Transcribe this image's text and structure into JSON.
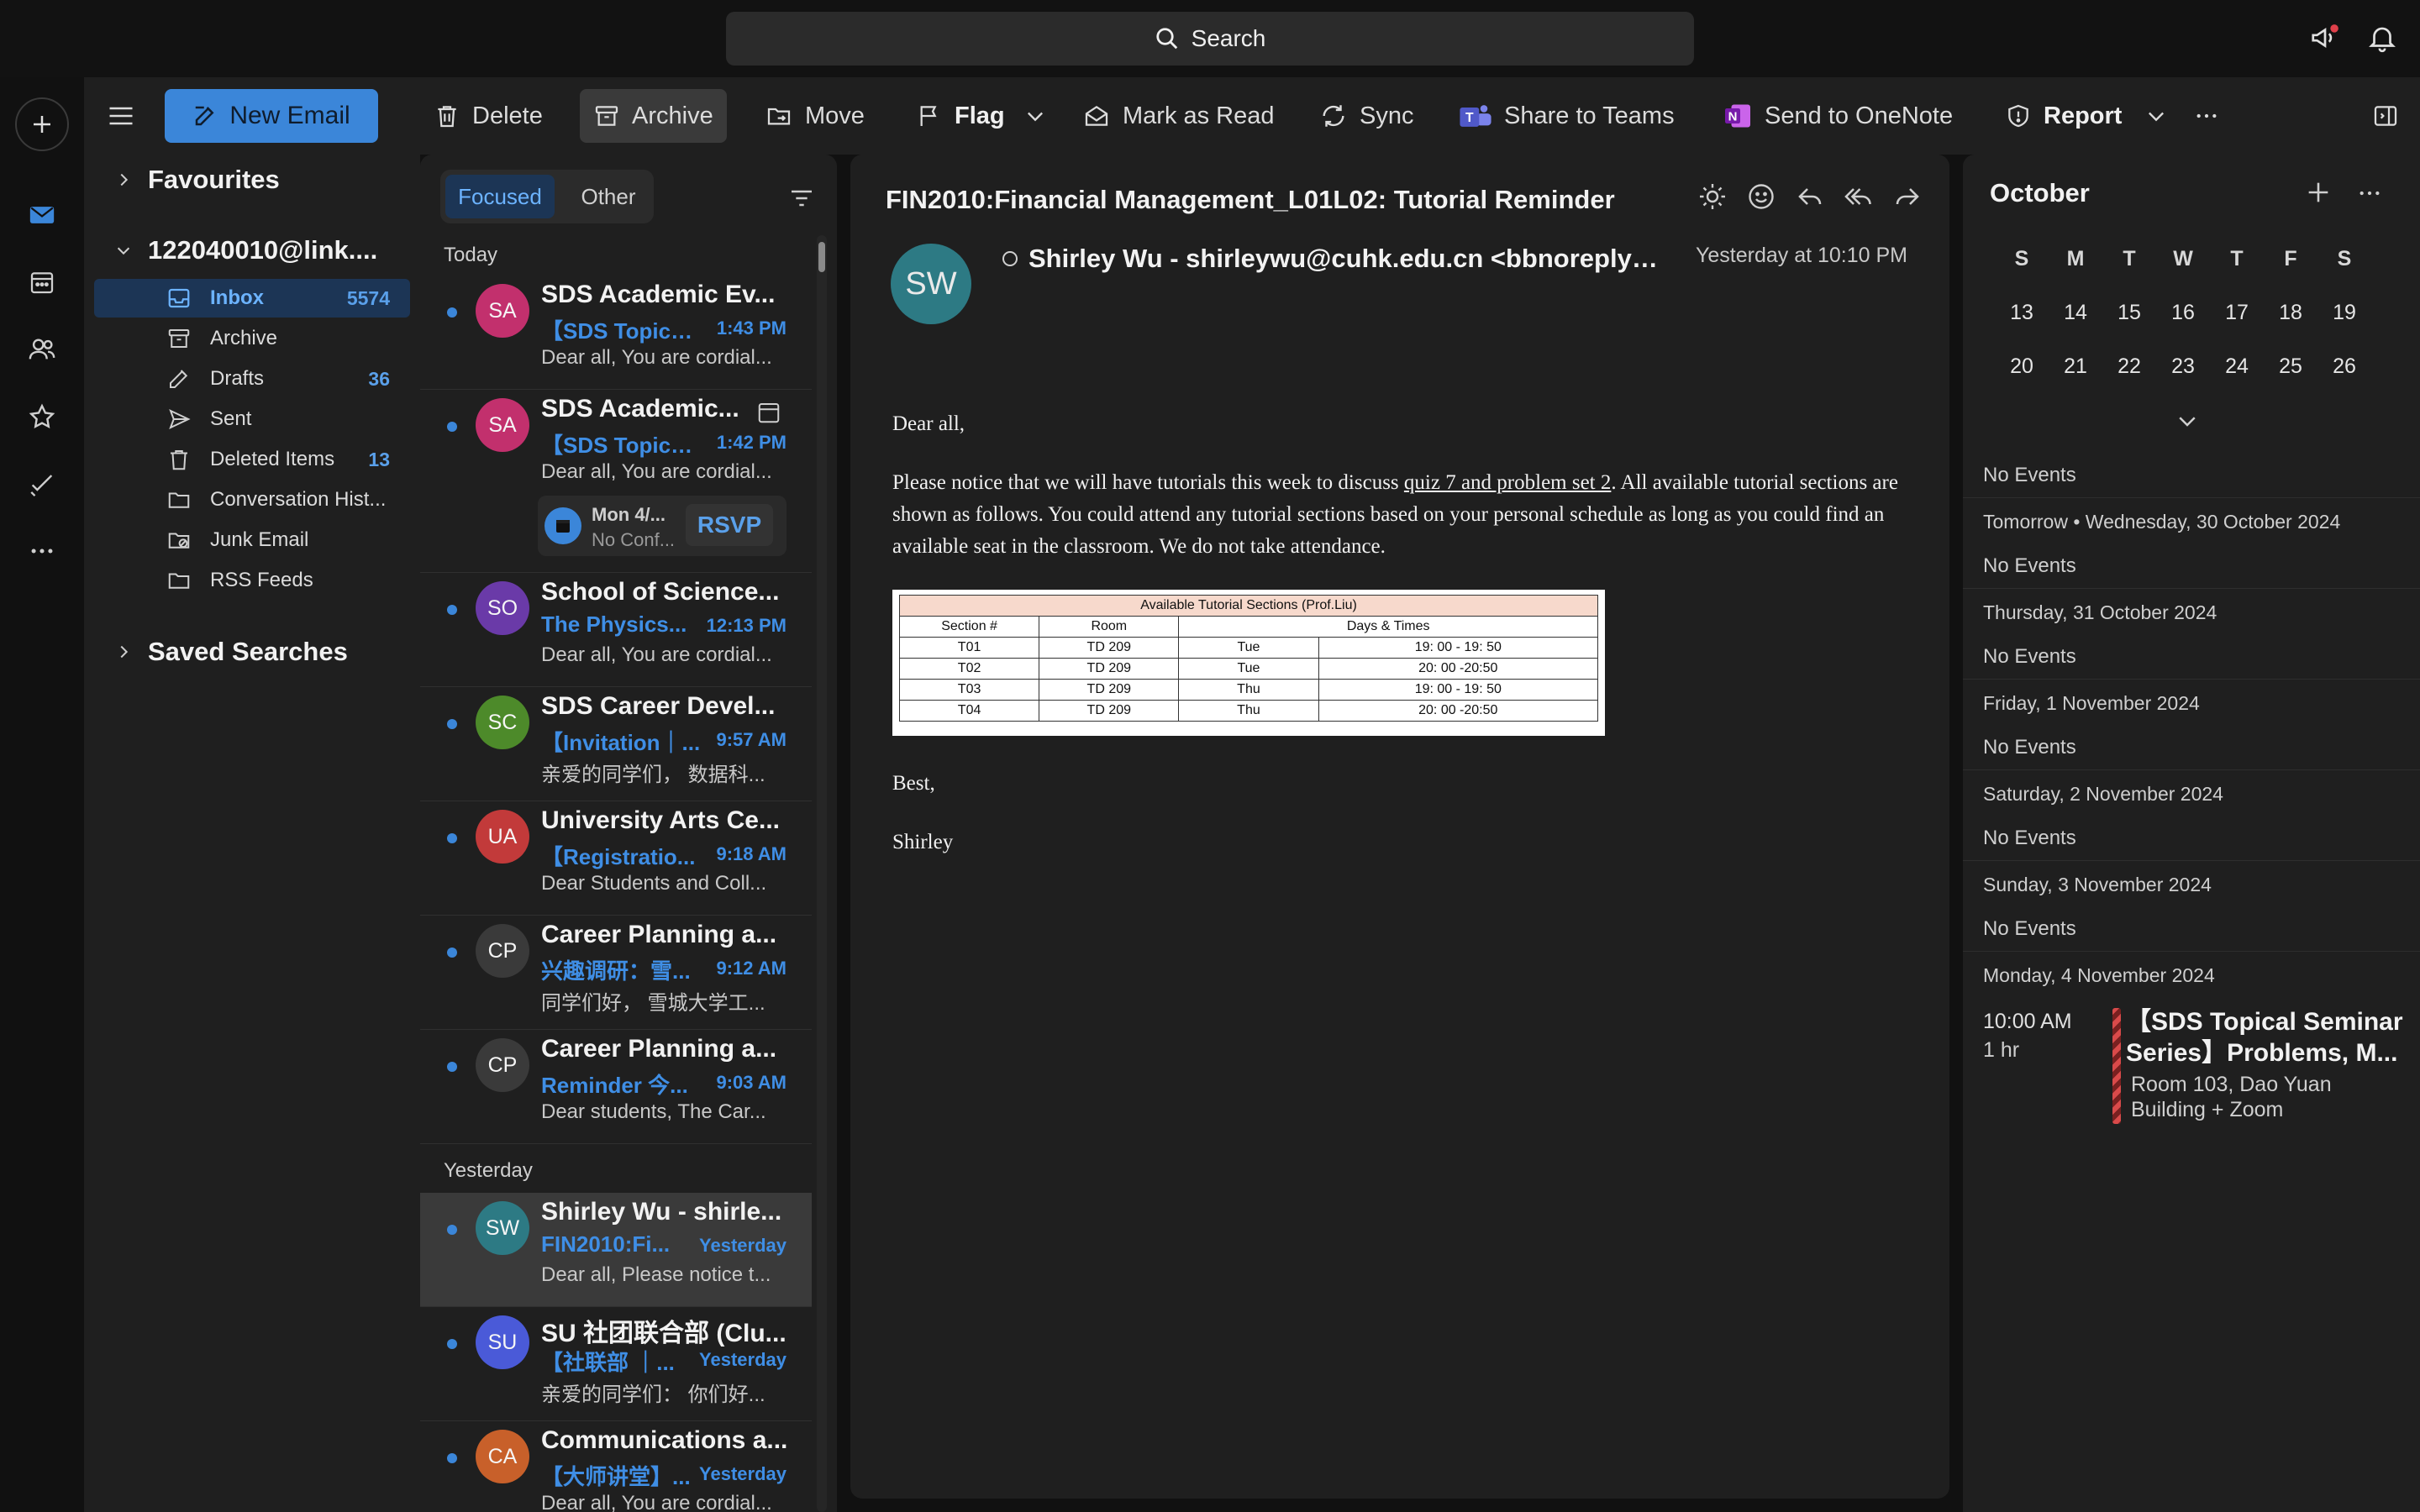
{
  "search": {
    "label": "Search"
  },
  "toolbar": {
    "new_email": "New Email",
    "delete": "Delete",
    "archive": "Archive",
    "move": "Move",
    "flag": "Flag",
    "mark_as_read": "Mark as Read",
    "sync": "Sync",
    "share_to_teams": "Share to Teams",
    "send_to_onenote": "Send to OneNote",
    "report": "Report"
  },
  "folders": {
    "favourites": "Favourites",
    "account": "122040010@link....",
    "items": [
      {
        "label": "Inbox",
        "count": "5574",
        "icon": "inbox-icon"
      },
      {
        "label": "Archive",
        "count": "",
        "icon": "archive-icon"
      },
      {
        "label": "Drafts",
        "count": "36",
        "icon": "drafts-icon"
      },
      {
        "label": "Sent",
        "count": "",
        "icon": "sent-icon"
      },
      {
        "label": "Deleted Items",
        "count": "13",
        "icon": "trash-icon"
      },
      {
        "label": "Conversation Hist...",
        "count": "",
        "icon": "folder-icon"
      },
      {
        "label": "Junk Email",
        "count": "",
        "icon": "junk-icon"
      },
      {
        "label": "RSS Feeds",
        "count": "",
        "icon": "folder-icon"
      }
    ],
    "saved_searches": "Saved Searches"
  },
  "list": {
    "focused": "Focused",
    "other": "Other",
    "groups": {
      "today": "Today",
      "yesterday": "Yesterday"
    },
    "messages": [
      {
        "initials": "SA",
        "color": "#c2306d",
        "from": "SDS Academic Ev...",
        "subject": "【SDS Topical...",
        "time": "1:43 PM",
        "preview": "Dear all, You are cordial..."
      },
      {
        "initials": "SA",
        "color": "#c2306d",
        "from": "SDS Academic...",
        "subject": "【SDS Topical...",
        "time": "1:42 PM",
        "preview": "Dear all, You are cordial...",
        "rsvp": {
          "date": "Mon 4/...",
          "status": "No Conf...",
          "label": "RSVP"
        }
      },
      {
        "initials": "SO",
        "color": "#6a3aa8",
        "from": "School of Science...",
        "subject": "The Physics...",
        "time": "12:13 PM",
        "preview": "Dear all, You are cordial..."
      },
      {
        "initials": "SC",
        "color": "#4d8a2a",
        "from": "SDS Career Devel...",
        "subject": "【Invitation｜...",
        "time": "9:57 AM",
        "preview": "亲爱的同学们， 数据科..."
      },
      {
        "initials": "UA",
        "color": "#c23a3a",
        "from": "University Arts Ce...",
        "subject": "【Registratio...",
        "time": "9:18 AM",
        "preview": "Dear Students and Coll..."
      },
      {
        "initials": "CP",
        "color": "#3a3a3a",
        "from": "Career Planning a...",
        "subject": "兴趣调研：雪...",
        "time": "9:12 AM",
        "preview": "同学们好， 雪城大学工..."
      },
      {
        "initials": "CP",
        "color": "#3a3a3a",
        "from": "Career Planning a...",
        "subject": "Reminder 今...",
        "time": "9:03 AM",
        "preview": "Dear students, The Car..."
      },
      {
        "initials": "SW",
        "color": "#2d7a84",
        "from": "Shirley Wu - shirle...",
        "subject": "FIN2010:Fi...",
        "time": "Yesterday",
        "preview": "Dear all, Please notice t..."
      },
      {
        "initials": "SU",
        "color": "#4a5ad8",
        "from": "SU 社团联合部 (Clu...",
        "subject": "【社联部 ｜...",
        "time": "Yesterday",
        "preview": "亲爱的同学们： 你们好..."
      },
      {
        "initials": "CA",
        "color": "#c8602a",
        "from": "Communications a...",
        "subject": "【大师讲堂】...",
        "time": "Yesterday",
        "preview": "Dear all, You are cordial..."
      }
    ]
  },
  "reading": {
    "subject": "FIN2010:Financial Management_L01L02: Tutorial Reminder",
    "avatar": "SW",
    "from": "Shirley Wu - shirleywu@cuhk.edu.cn <bbnoreply@...",
    "date": "Yesterday at 10:10 PM",
    "greeting": "Dear all,",
    "para_pre": "Please notice that we will have tutorials this week to discuss ",
    "para_link": "quiz 7 and problem set 2",
    "para_post": ". All available tutorial sections are shown as follows. You could attend any tutorial sections based on your personal schedule as long as you could find an available seat in the classroom. We do not take attendance.",
    "table": {
      "caption": "Available Tutorial Sections (Prof.Liu)",
      "headers": [
        "Section #",
        "Room",
        "Days & Times"
      ],
      "rows": [
        [
          "T01",
          "TD 209",
          "Tue",
          "19: 00 - 19: 50"
        ],
        [
          "T02",
          "TD 209",
          "Tue",
          "20: 00 -20:50"
        ],
        [
          "T03",
          "TD 209",
          "Thu",
          "19: 00 - 19: 50"
        ],
        [
          "T04",
          "TD 209",
          "Thu",
          "20: 00 -20:50"
        ]
      ]
    },
    "closing": "Best,",
    "signature": "Shirley"
  },
  "calendar": {
    "month": "October",
    "dow": [
      "S",
      "M",
      "T",
      "W",
      "T",
      "F",
      "S"
    ],
    "week1": [
      "13",
      "14",
      "15",
      "16",
      "17",
      "18",
      "19"
    ],
    "week2": [
      "20",
      "21",
      "22",
      "23",
      "24",
      "25",
      "26"
    ],
    "no_events": "No Events",
    "days": [
      "Tomorrow • Wednesday, 30 October 2024",
      "Thursday, 31 October 2024",
      "Friday, 1 November 2024",
      "Saturday, 2 November 2024",
      "Sunday, 3 November 2024",
      "Monday, 4 November 2024"
    ],
    "event": {
      "time": "10:00 AM",
      "duration": "1 hr",
      "title": "【SDS Topical Seminar Series】Problems, M...",
      "location": "Room 103, Dao Yuan Building + Zoom"
    }
  }
}
